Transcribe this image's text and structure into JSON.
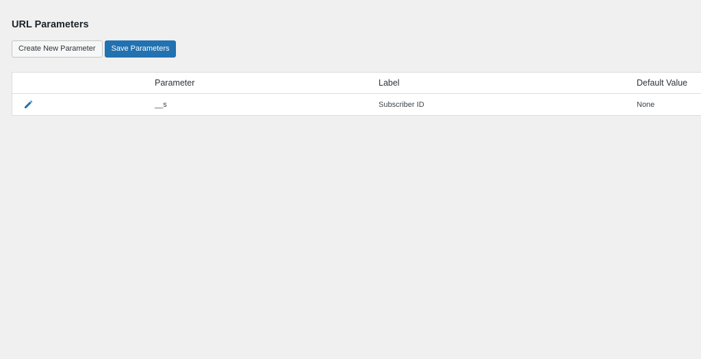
{
  "header": {
    "title": "URL Parameters"
  },
  "toolbar": {
    "create_label": "Create New Parameter",
    "save_label": "Save Parameters"
  },
  "table": {
    "columns": [
      "",
      "Parameter",
      "Label",
      "Default Value"
    ],
    "rows": [
      {
        "action_icon": "pencil-icon",
        "parameter": "__s",
        "label": "Subscriber ID",
        "default_value": "None"
      }
    ]
  },
  "colors": {
    "accent": "#2271b1",
    "background": "#f0f0f1"
  }
}
